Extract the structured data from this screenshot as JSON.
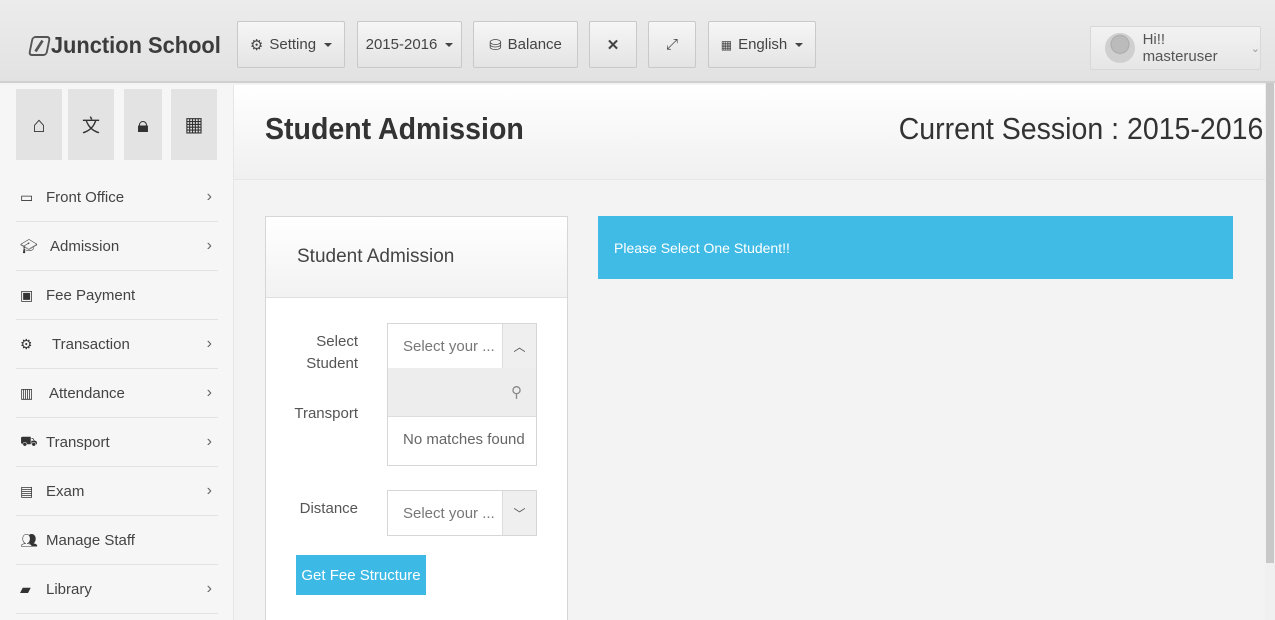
{
  "brand": {
    "name": "Junction School"
  },
  "topbar": {
    "setting_label": "Setting",
    "session_label": "2015-2016",
    "balance_label": "Balance",
    "language_label": "English",
    "user_label": "Hi!! masteruser"
  },
  "sidebar": {
    "quick_icons": [
      "home-icon",
      "language-icon",
      "lock-icon",
      "calendar-icon"
    ],
    "items": [
      {
        "label": "Front Office",
        "icon": "monitor-icon",
        "has_submenu": true
      },
      {
        "label": "Admission",
        "icon": "graduation-cap-icon",
        "has_submenu": true
      },
      {
        "label": "Fee Payment",
        "icon": "money-icon",
        "has_submenu": false
      },
      {
        "label": "Transaction",
        "icon": "gear-icon",
        "has_submenu": true
      },
      {
        "label": "Attendance",
        "icon": "bar-chart-icon",
        "has_submenu": true
      },
      {
        "label": "Transport",
        "icon": "bus-icon",
        "has_submenu": true
      },
      {
        "label": "Exam",
        "icon": "file-icon",
        "has_submenu": true
      },
      {
        "label": "Manage Staff",
        "icon": "users-icon",
        "has_submenu": false
      },
      {
        "label": "Library",
        "icon": "book-icon",
        "has_submenu": true
      }
    ]
  },
  "header": {
    "title": "Student Admission",
    "session_text": "Current Session : 2015-2016"
  },
  "panel": {
    "title": "Student Admission",
    "select_student_label": "Select Student",
    "select_student_placeholder": "Select your ...",
    "transport_label": "Transport",
    "dropdown_search_value": "",
    "dropdown_message": "No matches found",
    "distance_label": "Distance",
    "distance_placeholder": "Select your ...",
    "submit_label": "Get Fee Structure"
  },
  "alert": {
    "message": "Please Select One Student!!"
  },
  "colors": {
    "accent": "#3fbbe6",
    "button": "#3db9e5"
  }
}
